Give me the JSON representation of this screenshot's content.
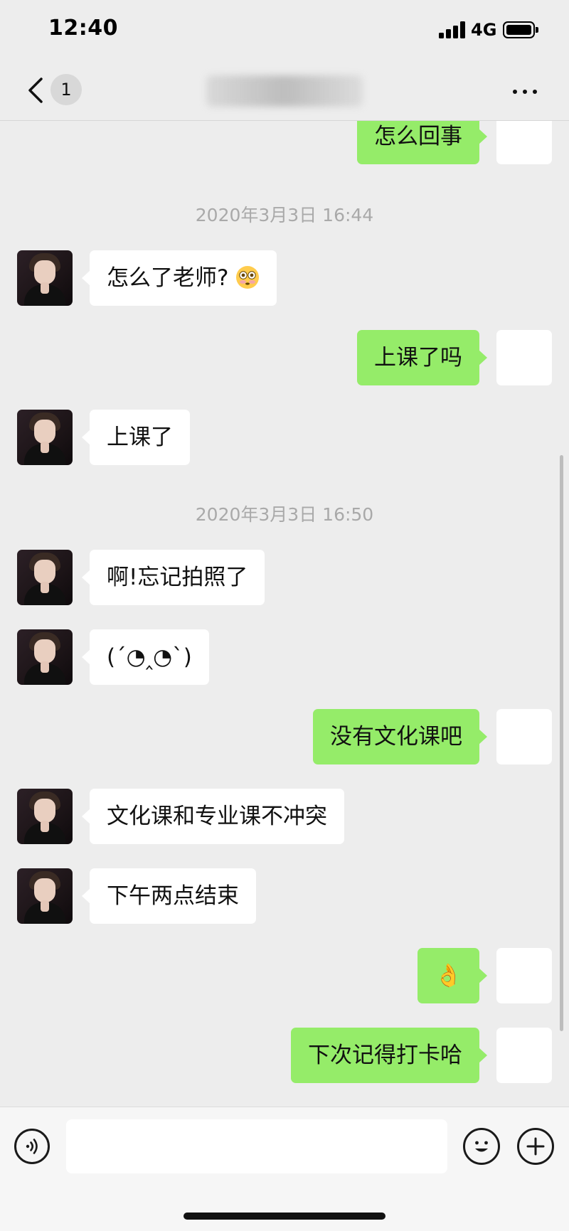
{
  "status_bar": {
    "time": "12:40",
    "network": "4G",
    "icons": [
      "signal-icon",
      "battery-icon"
    ]
  },
  "nav": {
    "unread_count": "1",
    "title": "",
    "icons": [
      "back-icon",
      "more-icon"
    ]
  },
  "messages": [
    {
      "kind": "text",
      "side": "right",
      "text": "怎么回事"
    },
    {
      "kind": "time",
      "text": "2020年3月3日 16:44"
    },
    {
      "kind": "text",
      "side": "left",
      "text": "怎么了老师?",
      "emoji": "flushed-face-emoji"
    },
    {
      "kind": "text",
      "side": "right",
      "text": "上课了吗"
    },
    {
      "kind": "text",
      "side": "left",
      "text": "上课了"
    },
    {
      "kind": "time",
      "text": "2020年3月3日 16:50"
    },
    {
      "kind": "text",
      "side": "left",
      "text": "啊!忘记拍照了"
    },
    {
      "kind": "text",
      "side": "left",
      "text": "(´◔‸◔`)"
    },
    {
      "kind": "text",
      "side": "right",
      "text": "没有文化课吧"
    },
    {
      "kind": "text",
      "side": "left",
      "text": "文化课和专业课不冲突"
    },
    {
      "kind": "text",
      "side": "left",
      "text": "下午两点结束"
    },
    {
      "kind": "text",
      "side": "right",
      "text": "👌"
    },
    {
      "kind": "text",
      "side": "right",
      "text": "下次记得打卡哈"
    }
  ],
  "input_bar": {
    "placeholder": "",
    "icons": [
      "voice-icon",
      "emoji-face-icon",
      "plus-icon"
    ]
  },
  "colors": {
    "background": "#ededed",
    "outgoing_bubble": "#95ec69",
    "incoming_bubble": "#ffffff",
    "timestamp_text": "#a9a9a9"
  }
}
